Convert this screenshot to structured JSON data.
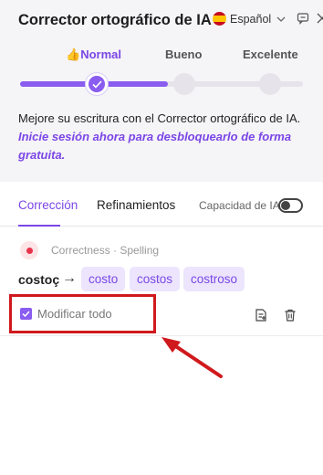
{
  "header": {
    "title": "Corrector ortográfico de IA",
    "language": "Español",
    "language_flag": "spain-flag-icon",
    "steps": [
      {
        "label": "Normal",
        "prefix_icon": "👍",
        "active": true
      },
      {
        "label": "Bueno",
        "active": false
      },
      {
        "label": "Excelente",
        "active": false
      }
    ],
    "progress_level": 0.5,
    "description": "Mejore su escritura con el Corrector ortográfico de IA. ",
    "description_link": "Inicie sesión ahora para desbloquearlo de forma gratuita."
  },
  "tabs": {
    "items": [
      "Corrección",
      "Refinamientos"
    ],
    "active": "Corrección",
    "ai_capacity_label": "Capacidad de IA",
    "ai_capacity_on": false
  },
  "suggestion": {
    "category": "Correctness · Spelling",
    "original": "costoç",
    "arrow": "→",
    "options": [
      "costo",
      "costos",
      "costroso"
    ],
    "modify_all_label": "Modificar todo",
    "modify_all_checked": true
  },
  "colors": {
    "accent": "#7b46e6",
    "error_dot": "#e8334a",
    "highlight_box": "#d0191c"
  }
}
